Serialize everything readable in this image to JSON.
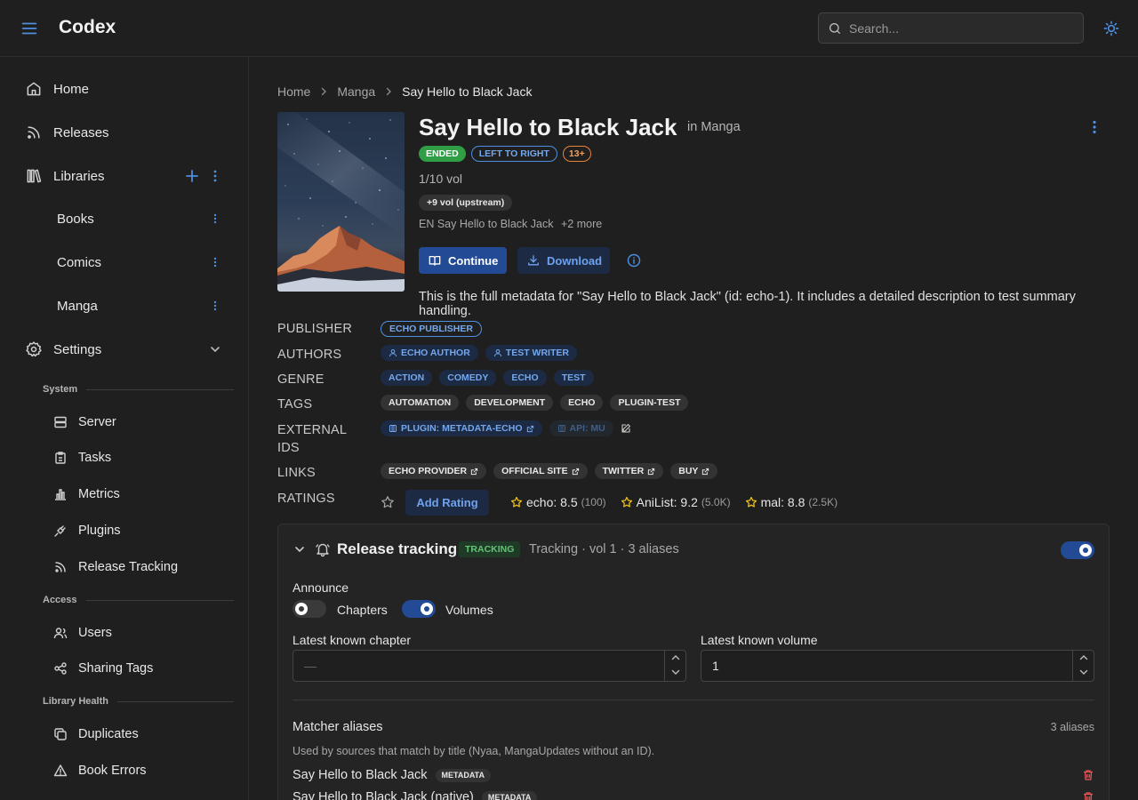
{
  "app": {
    "brand": "Codex",
    "search_placeholder": "Search..."
  },
  "sidebar": {
    "home": "Home",
    "releases": "Releases",
    "libraries": "Libraries",
    "libs": [
      "Books",
      "Comics",
      "Manga"
    ],
    "settings": "Settings",
    "system_heading": "System",
    "system": [
      "Server",
      "Tasks",
      "Metrics",
      "Plugins",
      "Release Tracking"
    ],
    "access_heading": "Access",
    "access": [
      "Users",
      "Sharing Tags"
    ],
    "health_heading": "Library Health",
    "health": [
      "Duplicates",
      "Book Errors"
    ]
  },
  "breadcrumb": [
    "Home",
    "Manga",
    "Say Hello to Black Jack"
  ],
  "series": {
    "title": "Say Hello to Black Jack",
    "in_library": "in Manga",
    "status": "ENDED",
    "reading_direction": "LEFT TO RIGHT",
    "age_rating": "13+",
    "volumes": "1/10 vol",
    "upstream": "+9 vol (upstream)",
    "alt_title": "EN Say Hello to Black Jack",
    "alt_more": "+2 more",
    "continue_label": "Continue",
    "download_label": "Download",
    "description": "This is the full metadata for \"Say Hello to Black Jack\" (id: echo-1). It includes a detailed description to test summary handling."
  },
  "metadata": {
    "publisher_label": "PUBLISHER",
    "publisher": "ECHO PUBLISHER",
    "authors_label": "AUTHORS",
    "authors": [
      "ECHO AUTHOR",
      "TEST WRITER"
    ],
    "genre_label": "GENRE",
    "genres": [
      "ACTION",
      "COMEDY",
      "ECHO",
      "TEST"
    ],
    "tags_label": "TAGS",
    "tags": [
      "AUTOMATION",
      "DEVELOPMENT",
      "ECHO",
      "PLUGIN-TEST"
    ],
    "external_ids_label_1": "EXTERNAL",
    "external_ids_label_2": "IDS",
    "external_ids": [
      "PLUGIN: METADATA-ECHO",
      "API: MU"
    ],
    "links_label": "LINKS",
    "links": [
      "ECHO PROVIDER",
      "OFFICIAL SITE",
      "TWITTER",
      "BUY"
    ],
    "ratings_label": "RATINGS",
    "add_rating": "Add Rating",
    "ratings": [
      {
        "source": "echo: 8.5",
        "count": "(100)"
      },
      {
        "source": "AniList: 9.2",
        "count": "(5.0K)"
      },
      {
        "source": "mal: 8.8",
        "count": "(2.5K)"
      }
    ]
  },
  "release_tracking": {
    "title": "Release tracking",
    "badge": "TRACKING",
    "summary": "Tracking · vol 1 · 3 aliases",
    "enabled": true,
    "announce_label": "Announce",
    "chapters_label": "Chapters",
    "chapters_on": false,
    "volumes_label": "Volumes",
    "volumes_on": true,
    "latest_chapter_label": "Latest known chapter",
    "latest_chapter_placeholder": "—",
    "latest_volume_label": "Latest known volume",
    "latest_volume_value": "1",
    "aliases_heading": "Matcher aliases",
    "aliases_count": "3 aliases",
    "aliases_desc": "Used by sources that match by title (Nyaa, MangaUpdates without an ID).",
    "aliases": [
      {
        "title": "Say Hello to Black Jack",
        "source": "METADATA"
      },
      {
        "title": "Say Hello to Black Jack (native)",
        "source": "METADATA"
      }
    ]
  },
  "colors": {
    "accent": "#4d8fe0",
    "primary_button": "#234a94",
    "ended": "#2f9e44",
    "age": "#e8833a",
    "star": "#f0c419",
    "danger": "#e8585a"
  }
}
